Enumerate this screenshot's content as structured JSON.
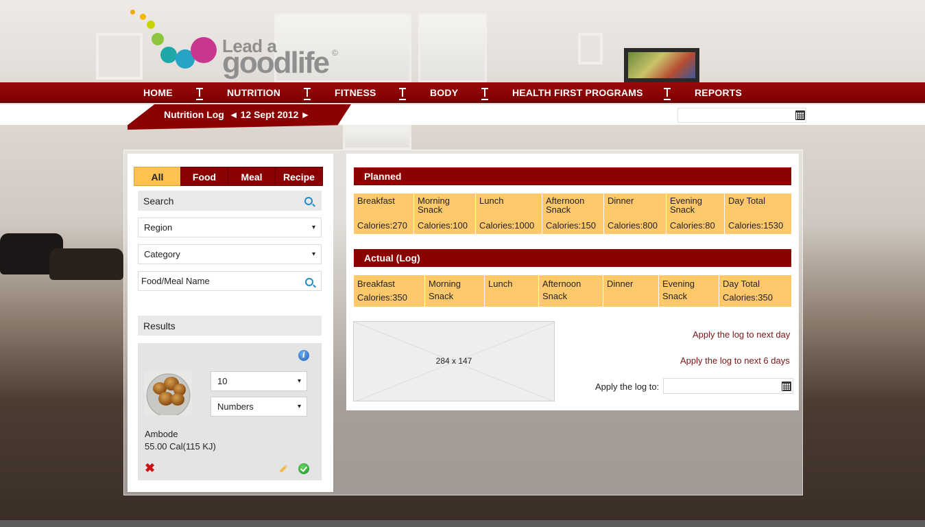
{
  "logo": {
    "line1": "Lead a",
    "line2": "goodlife",
    "mark": "©"
  },
  "nav": {
    "items": [
      "HOME",
      "NUTRITION",
      "FITNESS",
      "BODY",
      "HEALTH FIRST PROGRAMS",
      "REPORTS"
    ]
  },
  "subheader": {
    "title": "Nutrition Log",
    "prev_icon": "◄",
    "date": "12 Sept 2012",
    "next_icon": "►",
    "date_value": ""
  },
  "left": {
    "tabs": [
      "All",
      "Food",
      "Meal",
      "Recipe"
    ],
    "active_tab": "All",
    "search_label": "Search",
    "region": "Region",
    "category": "Category",
    "name_placeholder": "Food/Meal Name",
    "results_label": "Results",
    "result": {
      "quantity": "10",
      "unit": "Numbers",
      "name": "Ambode",
      "calories": "55.00 Cal(115 KJ)",
      "caret": "▾"
    }
  },
  "planned": {
    "title": "Planned",
    "meals": [
      {
        "name": "Breakfast",
        "calories": "Calories:270"
      },
      {
        "name": "Morning Snack",
        "calories": "Calories:100"
      },
      {
        "name": "Lunch",
        "calories": "Calories:1000"
      },
      {
        "name": "Afternoon Snack",
        "calories": "Calories:150"
      },
      {
        "name": "Dinner",
        "calories": "Calories:800"
      },
      {
        "name": "Evening Snack",
        "calories": "Calories:80"
      },
      {
        "name": "Day Total",
        "calories": "Calories:1530"
      }
    ]
  },
  "actual": {
    "title": "Actual (Log)",
    "meals": [
      {
        "name": "Breakfast",
        "calories": "Calories:350"
      },
      {
        "name": "Morning Snack",
        "calories": ""
      },
      {
        "name": "Lunch",
        "calories": ""
      },
      {
        "name": "Afternoon Snack",
        "calories": ""
      },
      {
        "name": "Dinner",
        "calories": ""
      },
      {
        "name": "Evening Snack",
        "calories": ""
      },
      {
        "name": "Day Total",
        "calories": "Calories:350"
      }
    ]
  },
  "image_placeholder": "284 x 147",
  "actions": {
    "next_day": "Apply the log to next day",
    "next_6_days": "Apply the log to next 6 days",
    "apply_to_label": "Apply the log to:",
    "apply_to_value": ""
  },
  "colors": {
    "brand": "#8b0000",
    "accent": "#ffc96b",
    "tab_active": "#ffc250",
    "link": "#7d1414"
  },
  "icons": [
    "search-icon",
    "calendar-icon",
    "info-icon",
    "delete-icon",
    "edit-icon",
    "confirm-icon",
    "chevron-down-icon"
  ]
}
